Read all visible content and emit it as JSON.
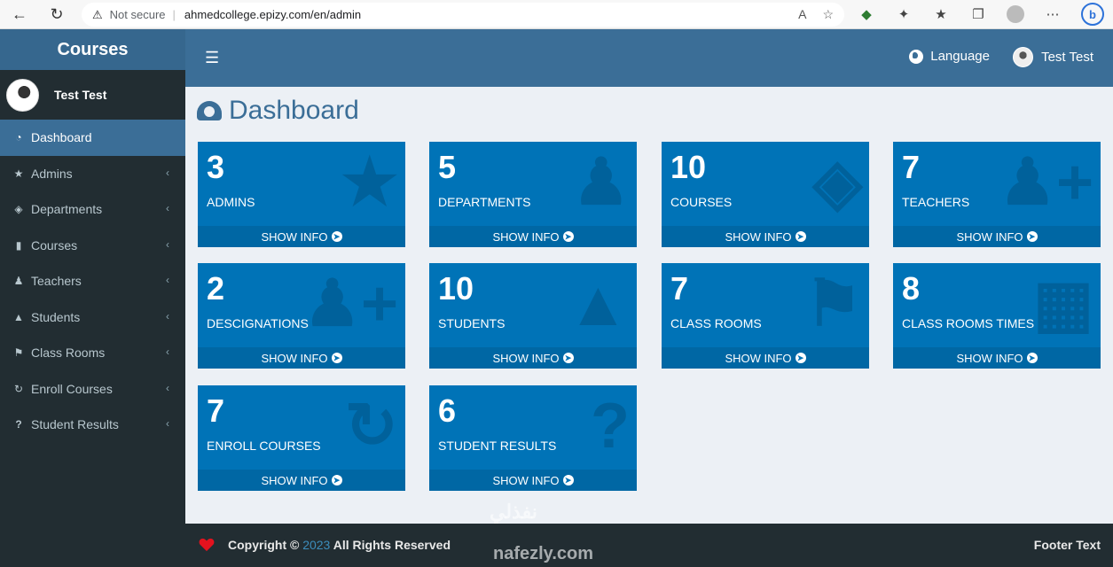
{
  "browser": {
    "security": "Not secure",
    "url": "ahmedcollege.epizy.com/en/admin"
  },
  "header": {
    "logo": "Courses",
    "language_label": "Language",
    "user_name": "Test Test"
  },
  "sidebar": {
    "user_name": "Test Test",
    "items": [
      {
        "label": "Dashboard",
        "icon": "dashboard-icon"
      },
      {
        "label": "Admins",
        "icon": "star-icon"
      },
      {
        "label": "Departments",
        "icon": "tags-icon"
      },
      {
        "label": "Courses",
        "icon": "book-icon"
      },
      {
        "label": "Teachers",
        "icon": "user-plus-icon"
      },
      {
        "label": "Students",
        "icon": "graduation-cap-icon"
      },
      {
        "label": "Class Rooms",
        "icon": "flag-icon"
      },
      {
        "label": "Enroll Courses",
        "icon": "refresh-icon"
      },
      {
        "label": "Student Results",
        "icon": "question-icon"
      }
    ]
  },
  "main": {
    "title": "Dashboard",
    "show_info_label": "SHOW INFO",
    "tiles": [
      {
        "count": "3",
        "label": "ADMINS",
        "icon": "star-icon"
      },
      {
        "count": "5",
        "label": "DEPARTMENTS",
        "icon": "user-icon"
      },
      {
        "count": "10",
        "label": "COURSES",
        "icon": "tags-icon"
      },
      {
        "count": "7",
        "label": "TEACHERS",
        "icon": "user-plus-icon"
      },
      {
        "count": "2",
        "label": "DESCIGNATIONS",
        "icon": "user-plus-icon"
      },
      {
        "count": "10",
        "label": "STUDENTS",
        "icon": "graduation-cap-icon"
      },
      {
        "count": "7",
        "label": "CLASS ROOMS",
        "icon": "flag-icon"
      },
      {
        "count": "8",
        "label": "CLASS ROOMS TIMES",
        "icon": "calendar-icon"
      },
      {
        "count": "7",
        "label": "ENROLL COURSES",
        "icon": "refresh-icon"
      },
      {
        "count": "6",
        "label": "STUDENT RESULTS",
        "icon": "question-icon"
      }
    ]
  },
  "footer": {
    "copyright_prefix": "Copyright ©",
    "year": "2023",
    "copyright_suffix": "All Rights Reserved",
    "right_text": "Footer Text"
  },
  "watermark": {
    "text": "نفذلي",
    "url": "nafezly.com"
  },
  "colors": {
    "tile_blue": "#0073b7",
    "header_blue": "#3b6e97",
    "sidebar_dark": "#222d32"
  }
}
